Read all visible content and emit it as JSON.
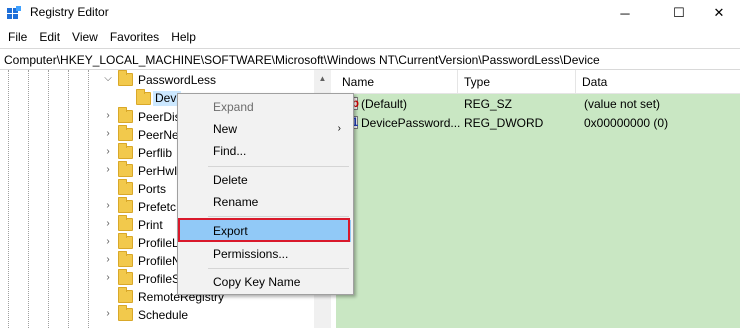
{
  "window": {
    "title": "Registry Editor",
    "minimize": "─",
    "maximize": "☐",
    "close": "✕"
  },
  "menu": [
    "File",
    "Edit",
    "View",
    "Favorites",
    "Help"
  ],
  "address": "Computer\\HKEY_LOCAL_MACHINE\\SOFTWARE\\Microsoft\\Windows NT\\CurrentVersion\\PasswordLess\\Device",
  "tree": [
    {
      "label": "PasswordLess",
      "expanded": true
    },
    {
      "label": "Devi",
      "selected": true
    },
    {
      "label": "PeerDis"
    },
    {
      "label": "PeerNe"
    },
    {
      "label": "Perflib"
    },
    {
      "label": "PerHwI"
    },
    {
      "label": "Ports"
    },
    {
      "label": "Prefetc"
    },
    {
      "label": "Print"
    },
    {
      "label": "ProfileL"
    },
    {
      "label": "ProfileN"
    },
    {
      "label": "ProfileS"
    },
    {
      "label": "RemoteRegistry"
    },
    {
      "label": "Schedule"
    }
  ],
  "columns": {
    "name": "Name",
    "type": "Type",
    "data": "Data"
  },
  "values": [
    {
      "icon": "ab",
      "name": "(Default)",
      "type": "REG_SZ",
      "data": "(value not set)"
    },
    {
      "icon": "binary",
      "name": "DevicePassword...",
      "type": "REG_DWORD",
      "data": "0x00000000 (0)"
    }
  ],
  "context_menu": {
    "expand": "Expand",
    "new": "New",
    "find": "Find...",
    "delete": "Delete",
    "rename": "Rename",
    "export": "Export",
    "permissions": "Permissions...",
    "copy_key_name": "Copy Key Name"
  },
  "colors": {
    "values_background": "#c9e7c3",
    "highlight": "#91c9f7",
    "annotation_box": "#d9192b"
  }
}
